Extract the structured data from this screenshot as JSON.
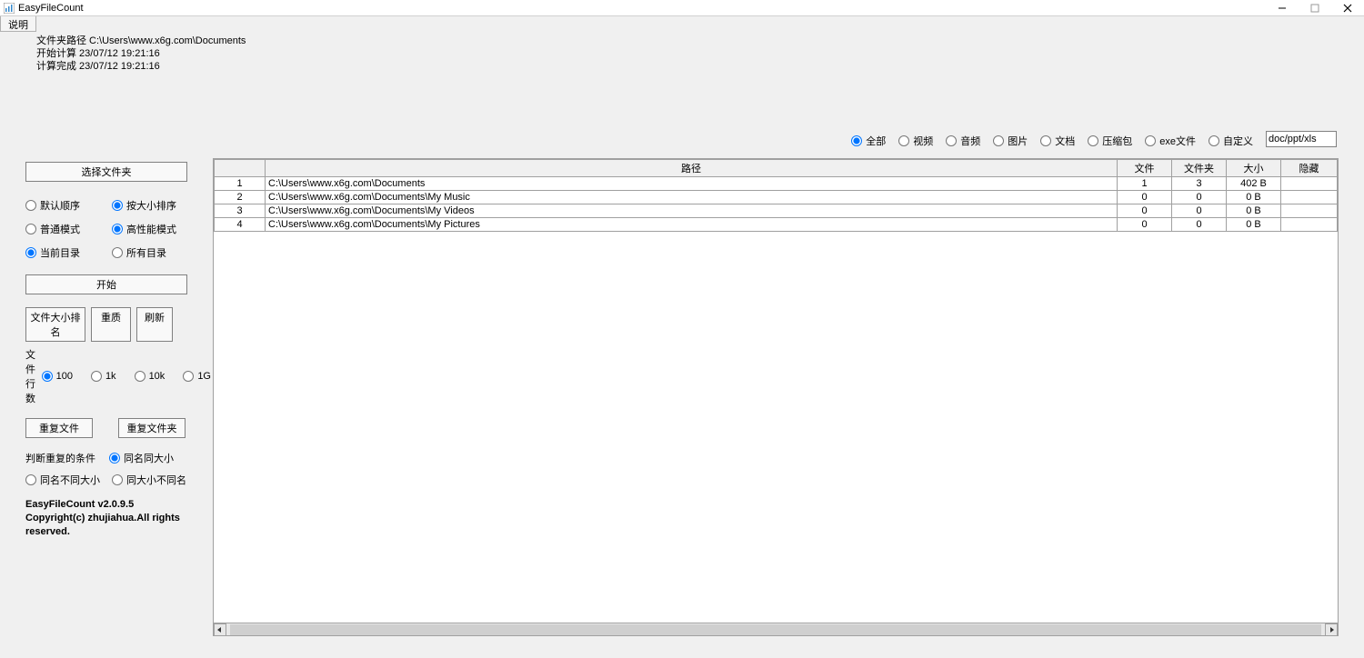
{
  "window": {
    "title": "EasyFileCount"
  },
  "menu": {
    "explain": "说明"
  },
  "info": {
    "path_label": "文件夹路径 C:\\Users\\www.x6g.com\\Documents",
    "start_label": "开始计算 23/07/12 19:21:16",
    "done_label": "计算完成 23/07/12 19:21:16"
  },
  "sidebar": {
    "choose_folder": "选择文件夹",
    "sort_default": "默认顺序",
    "sort_bysize": "按大小排序",
    "mode_normal": "普通模式",
    "mode_highperf": "高性能模式",
    "scope_current": "当前目录",
    "scope_all": "所有目录",
    "start": "开始",
    "rank": "文件大小排名",
    "preview": "重质",
    "refresh": "刷新",
    "file_rows": "文件行数",
    "rows_100": "100",
    "rows_1k": "1k",
    "rows_10k": "10k",
    "rows_1g": "1G",
    "dup_files": "重复文件",
    "dup_folders": "重复文件夹",
    "dup_cond": "判断重复的条件",
    "same_name_size": "同名同大小",
    "same_name_diff": "同名不同大小",
    "same_size_diff": "同大小不同名",
    "version": "EasyFileCount v2.0.9.5",
    "copyright": "Copyright(c) zhujiahua.All rights reserved."
  },
  "filters": {
    "all": "全部",
    "video": "视频",
    "audio": "音频",
    "image": "图片",
    "doc": "文档",
    "archive": "压缩包",
    "exe": "exe文件",
    "custom": "自定义",
    "custom_value": "doc/ppt/xls"
  },
  "table": {
    "headers": {
      "idx": "",
      "path": "路径",
      "files": "文件",
      "folders": "文件夹",
      "size": "大小",
      "hidden": "隐藏"
    },
    "rows": [
      {
        "idx": "1",
        "path": "C:\\Users\\www.x6g.com\\Documents",
        "files": "1",
        "folders": "3",
        "size": "402 B",
        "hidden": ""
      },
      {
        "idx": "2",
        "path": "C:\\Users\\www.x6g.com\\Documents\\My Music",
        "files": "0",
        "folders": "0",
        "size": "0 B",
        "hidden": ""
      },
      {
        "idx": "3",
        "path": "C:\\Users\\www.x6g.com\\Documents\\My Videos",
        "files": "0",
        "folders": "0",
        "size": "0 B",
        "hidden": ""
      },
      {
        "idx": "4",
        "path": "C:\\Users\\www.x6g.com\\Documents\\My Pictures",
        "files": "0",
        "folders": "0",
        "size": "0 B",
        "hidden": ""
      }
    ]
  }
}
